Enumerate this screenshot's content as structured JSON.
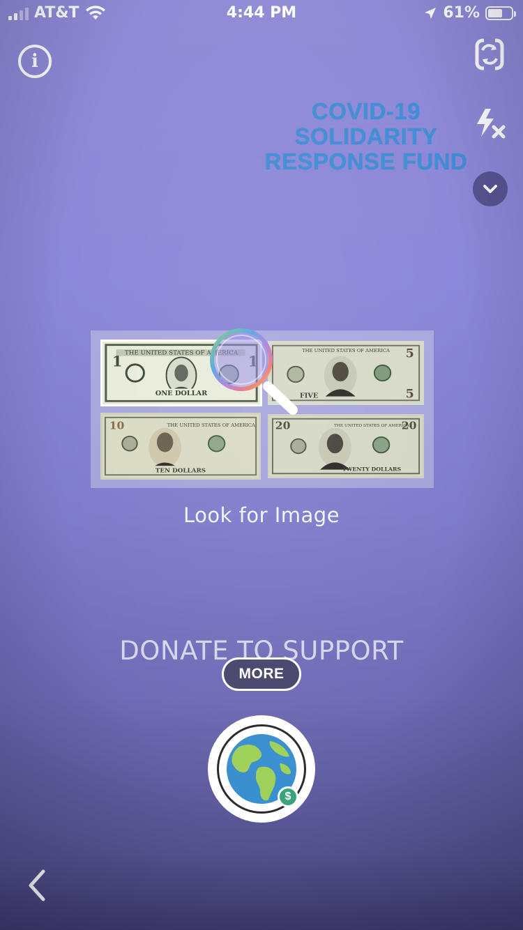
{
  "status_bar": {
    "carrier": "AT&T",
    "time": "4:44 PM",
    "battery_percent": "61%",
    "battery_level": 0.61,
    "icons": [
      "cell-signal-icon",
      "wifi-icon",
      "location-arrow-icon",
      "battery-icon"
    ]
  },
  "top_controls": {
    "info_icon": "info-icon",
    "flip_camera_icon": "camera-flip-icon",
    "flash_icon": "flash-off-icon",
    "chevron_icon": "chevron-down-icon"
  },
  "fund_logo": {
    "line1": "COVID-19",
    "line2": "SOLIDARITY",
    "line3": "RESPONSE FUND",
    "color": "#3f8fd6"
  },
  "scan_panel": {
    "bills": [
      {
        "denomination": "1",
        "name": "one-dollar-bill",
        "caption": "ONE DOLLAR",
        "header": "THE UNITED STATES OF AMERICA"
      },
      {
        "denomination": "5",
        "name": "five-dollar-bill",
        "caption": "FIVE",
        "header": "THE UNITED STATES OF AMERICA"
      },
      {
        "denomination": "10",
        "name": "ten-dollar-bill",
        "caption": "TEN DOLLARS",
        "header": "THE UNITED STATES OF AMERICA"
      },
      {
        "denomination": "20",
        "name": "twenty-dollar-bill",
        "caption": "TWENTY DOLLARS",
        "header": "THE UNITED STATES OF AMERICA"
      }
    ],
    "magnifier_icon": "magnifier-icon",
    "label": "Look for Image"
  },
  "donate": {
    "label": "DONATE TO SUPPORT",
    "more_button": "MORE"
  },
  "shutter": {
    "icon": "globe-icon",
    "badge_icon": "dollar-badge-icon",
    "badge_text": "$"
  },
  "back": {
    "icon": "back-chevron-icon"
  },
  "colors": {
    "background_top": "#8f8bd6",
    "background_bottom": "#3d3a6a",
    "more_button_bg": "#4a476e"
  }
}
